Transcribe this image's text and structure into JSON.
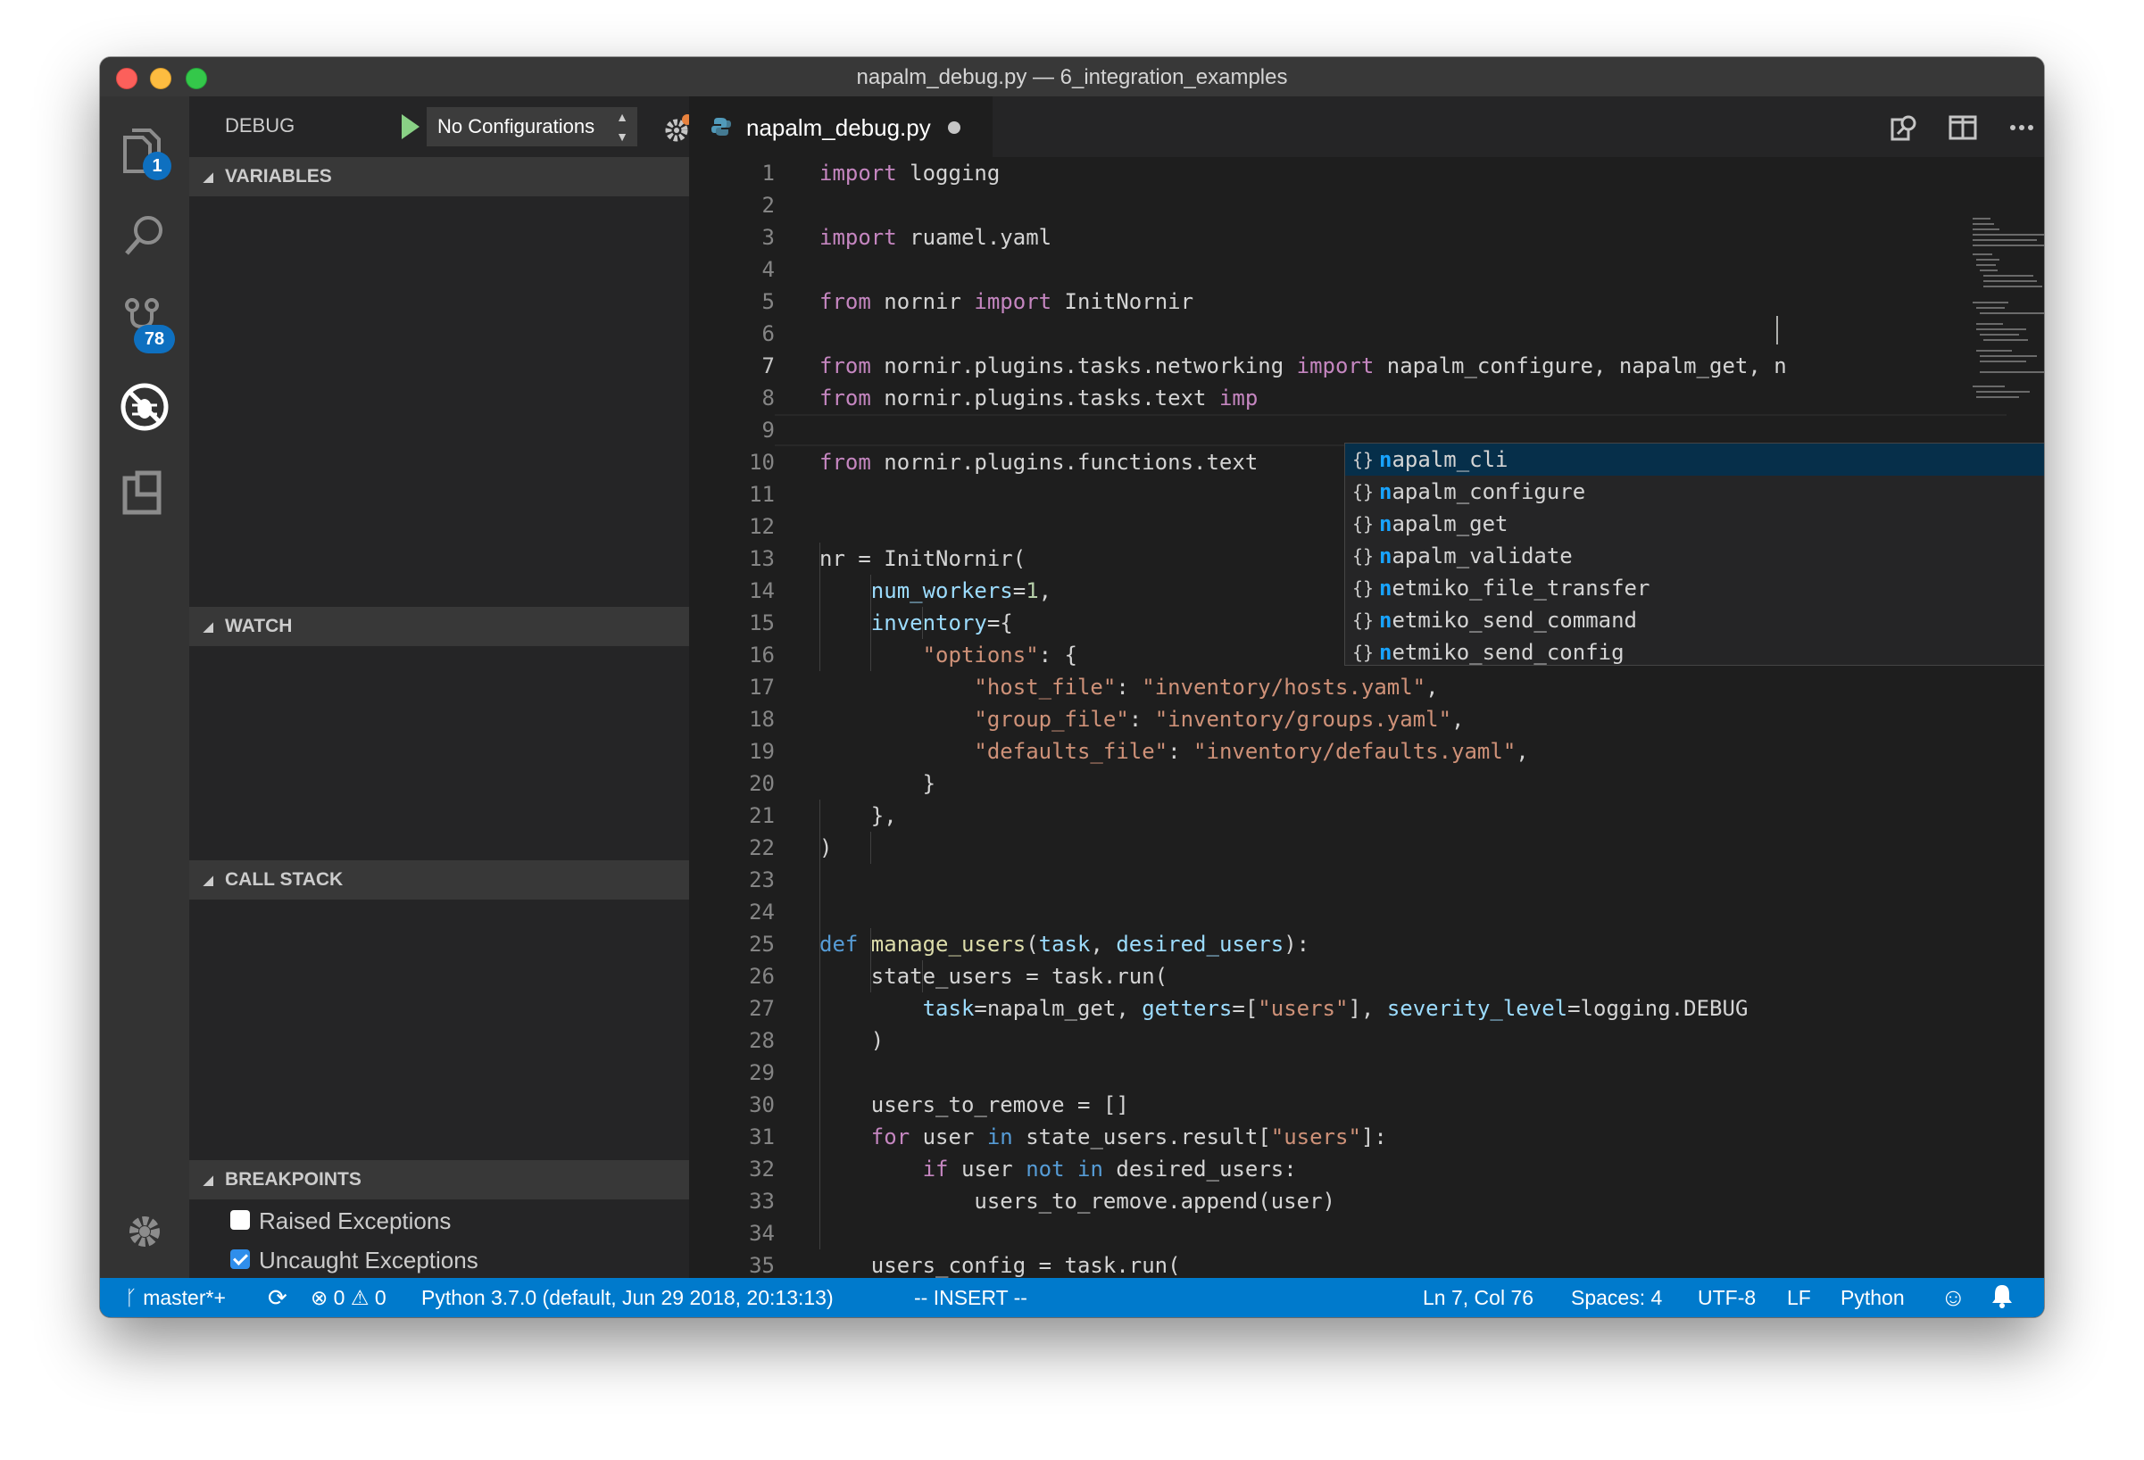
{
  "window": {
    "title": "napalm_debug.py — 6_integration_examples"
  },
  "activity_bar": {
    "explorer_badge": "1",
    "scm_badge": "78"
  },
  "debug": {
    "label": "DEBUG",
    "configuration": "No Configurations"
  },
  "sections": {
    "variables": "VARIABLES",
    "watch": "WATCH",
    "call_stack": "CALL STACK",
    "breakpoints": "BREAKPOINTS"
  },
  "breakpoints": [
    {
      "label": "Raised Exceptions",
      "checked": false
    },
    {
      "label": "Uncaught Exceptions",
      "checked": true
    }
  ],
  "tab": {
    "filename": "napalm_debug.py",
    "dirty": true
  },
  "line_numbers": [
    "1",
    "2",
    "3",
    "4",
    "5",
    "6",
    "7",
    "8",
    "9",
    "10",
    "11",
    "12",
    "13",
    "14",
    "15",
    "16",
    "17",
    "18",
    "19",
    "20",
    "21",
    "22",
    "23",
    "24",
    "25",
    "26",
    "27",
    "28",
    "29",
    "30",
    "31",
    "32",
    "33",
    "34",
    "35"
  ],
  "code": {
    "l1_kw": "import",
    "l1_rest": " logging",
    "l3_kw": "import",
    "l3_rest": " ruamel.yaml",
    "l5_kw1": "from",
    "l5_mid": " nornir ",
    "l5_kw2": "import",
    "l5_rest": " InitNornir",
    "l7_kw1": "from",
    "l7_mid": " nornir.plugins.tasks.networking ",
    "l7_kw2": "import",
    "l7_rest": " napalm_configure, napalm_get, n",
    "l8_kw1": "from",
    "l8_mid": " nornir.plugins.tasks.text ",
    "l8_kw2": "imp",
    "l10_kw1": "from",
    "l10_mid": " nornir.plugins.functions.text",
    "l13": "nr = InitNornir(",
    "l14_param": "num_workers",
    "l14_eq": "=",
    "l14_num": "1",
    "l14_end": ",",
    "l15_param": "inventory",
    "l15_end": "={",
    "l16_str": "\"options\"",
    "l16_end": ": {",
    "l17_key": "\"host_file\"",
    "l17_sep": ": ",
    "l17_val": "\"inventory/hosts.yaml\"",
    "l17_end": ",",
    "l18_key": "\"group_file\"",
    "l18_sep": ": ",
    "l18_val": "\"inventory/groups.yaml\"",
    "l18_end": ",",
    "l19_key": "\"defaults_file\"",
    "l19_sep": ": ",
    "l19_val": "\"inventory/defaults.yaml\"",
    "l19_end": ",",
    "l20": "}",
    "l21": "},",
    "l22": ")",
    "l25_kw": "def",
    "l25_fn": " manage_users",
    "l25_open": "(",
    "l25_p1": "task",
    "l25_comma": ", ",
    "l25_p2": "desired_users",
    "l25_close": "):",
    "l26": "state_users = task.run(",
    "l27_p1": "task",
    "l27_a": "=napalm_get, ",
    "l27_p2": "getters",
    "l27_b": "=[",
    "l27_s": "\"users\"",
    "l27_c": "], ",
    "l27_p3": "severity_level",
    "l27_d": "=logging.DEBUG",
    "l28": ")",
    "l30": "users_to_remove = []",
    "l31_kw": "for",
    "l31_a": " user ",
    "l31_kw2": "in",
    "l31_b": " state_users.result[",
    "l31_s": "\"users\"",
    "l31_c": "]:",
    "l32_kw": "if",
    "l32_a": " user ",
    "l32_kw2": "not",
    "l32_sp": " ",
    "l32_kw3": "in",
    "l32_b": " desired_users:",
    "l33": "users_to_remove.append(user)",
    "l35": "users_config = task.run("
  },
  "suggestions": [
    {
      "icon": "{}",
      "match": "n",
      "rest": "apalm_cli"
    },
    {
      "icon": "{}",
      "match": "n",
      "rest": "apalm_configure"
    },
    {
      "icon": "{}",
      "match": "n",
      "rest": "apalm_get"
    },
    {
      "icon": "{}",
      "match": "n",
      "rest": "apalm_validate"
    },
    {
      "icon": "{}",
      "match": "n",
      "rest": "etmiko_file_transfer"
    },
    {
      "icon": "{}",
      "match": "n",
      "rest": "etmiko_send_command"
    },
    {
      "icon": "{}",
      "match": "n",
      "rest": "etmiko_send_config"
    }
  ],
  "suggest_info": "i",
  "statusbar": {
    "branch": "master*+",
    "errors": "0",
    "warnings": "0",
    "interpreter": "Python 3.7.0 (default, Jun 29 2018, 20:13:13)",
    "mode": "-- INSERT --",
    "position": "Ln 7, Col 76",
    "spaces": "Spaces: 4",
    "encoding": "UTF-8",
    "eol": "LF",
    "language": "Python"
  },
  "colors": {
    "statusbar": "#007acc",
    "keyword": "#569cd6",
    "import_keyword": "#c586c0",
    "string": "#ce9178",
    "parameter": "#9cdcfe",
    "function": "#dcdcaa",
    "match_highlight": "#18a3ff"
  }
}
